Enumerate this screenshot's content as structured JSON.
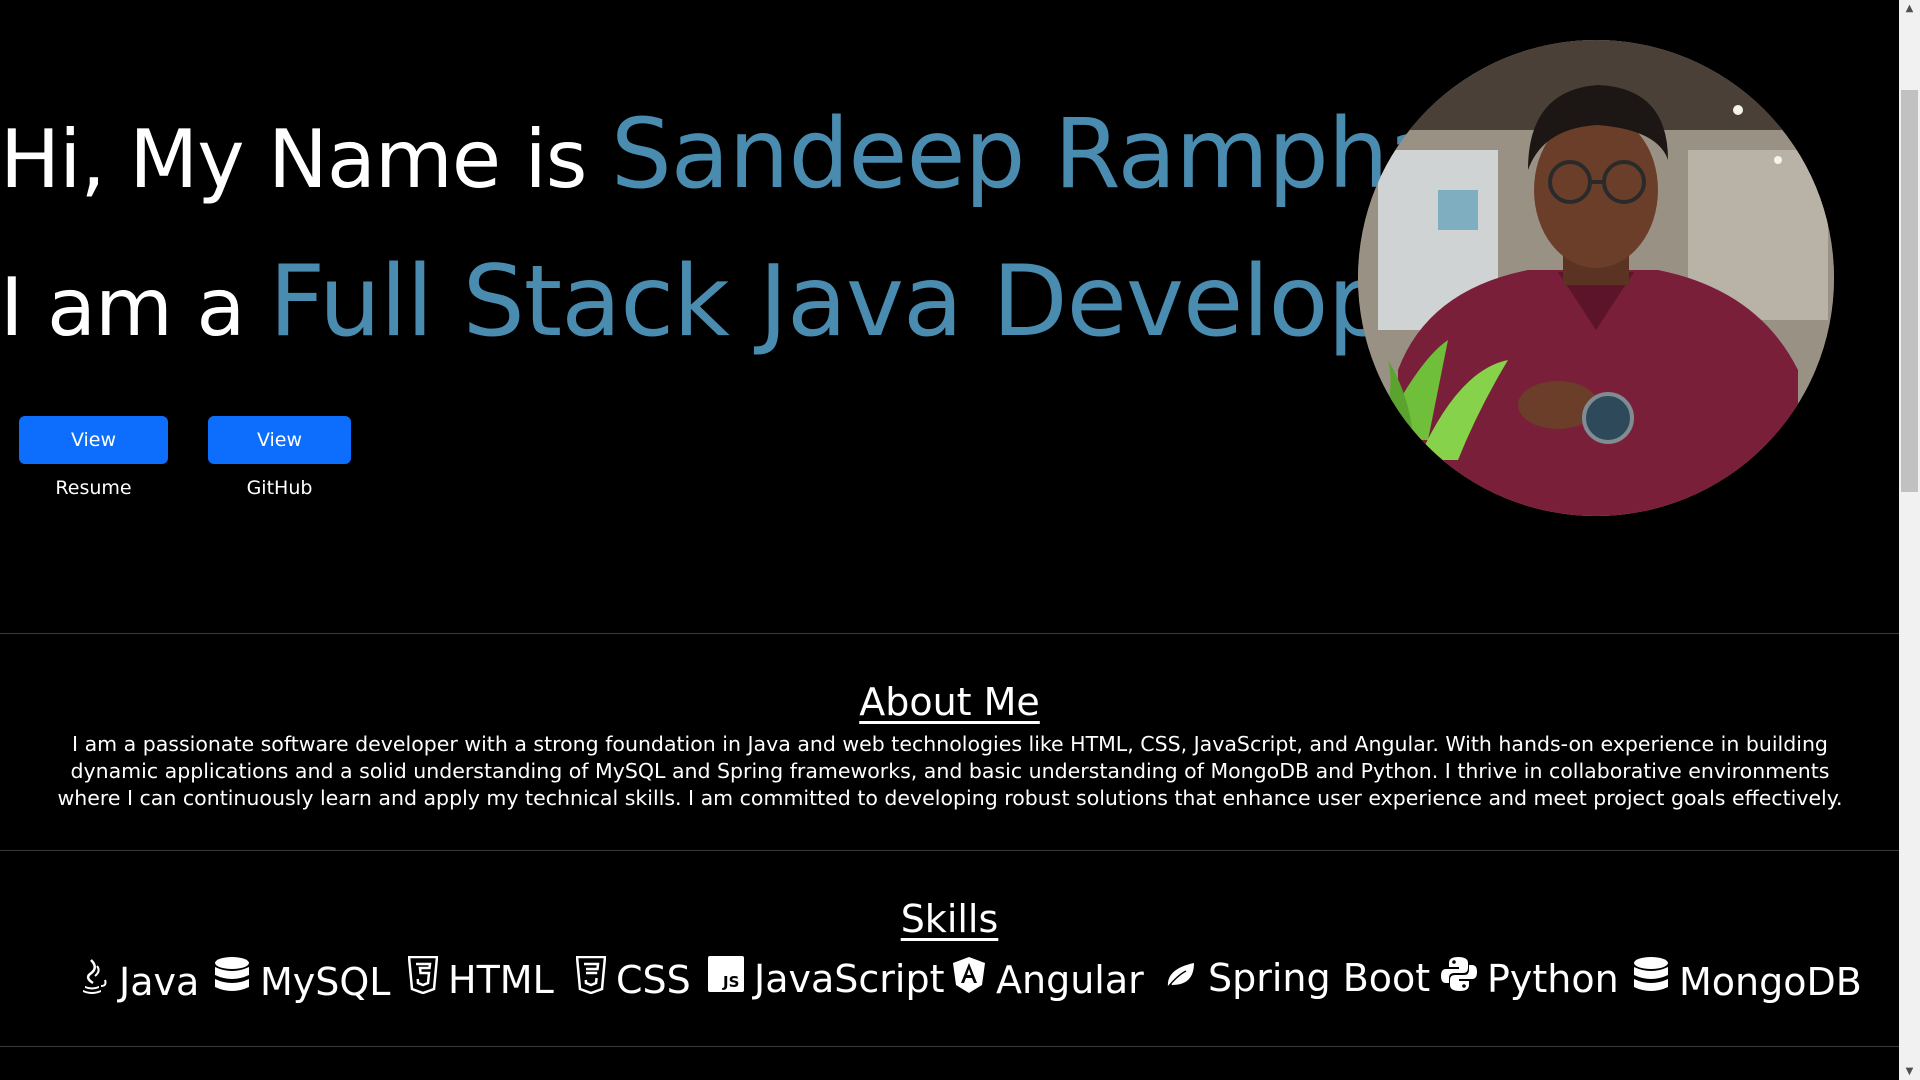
{
  "hero": {
    "line1_prefix": "Hi, My Name is ",
    "line1_name": "Sandeep Rampha,",
    "line2_prefix": "I am a ",
    "line2_role": "Full Stack Java Developer",
    "accent_color": "#4a8bb0"
  },
  "buttons": {
    "resume_label": "View Resume",
    "github_label": "View GitHub",
    "color": "#0d6efd"
  },
  "about": {
    "title": "About Me",
    "text": "I am a passionate software developer with a strong foundation in Java and web technologies like HTML, CSS, JavaScript, and Angular. With hands-on experience in building dynamic applications and a solid understanding of MySQL and Spring frameworks, and basic understanding of MongoDB and Python. I thrive in collaborative environments where I can continuously learn and apply my technical skills. I am committed to developing robust solutions that enhance user experience and meet project goals effectively."
  },
  "skills": {
    "title": "Skills",
    "items": [
      {
        "label": "Java",
        "icon": "java-icon"
      },
      {
        "label": "MySQL",
        "icon": "database-icon"
      },
      {
        "label": "HTML",
        "icon": "html5-icon"
      },
      {
        "label": "CSS",
        "icon": "css3-icon"
      },
      {
        "label": "JavaScript",
        "icon": "javascript-icon"
      },
      {
        "label": "Angular",
        "icon": "angular-icon"
      },
      {
        "label": "Spring Boot",
        "icon": "leaf-icon"
      },
      {
        "label": "Python",
        "icon": "python-icon"
      },
      {
        "label": "MongoDB",
        "icon": "database-icon"
      }
    ]
  },
  "profile_photo": {
    "icon": "profile-photo"
  }
}
